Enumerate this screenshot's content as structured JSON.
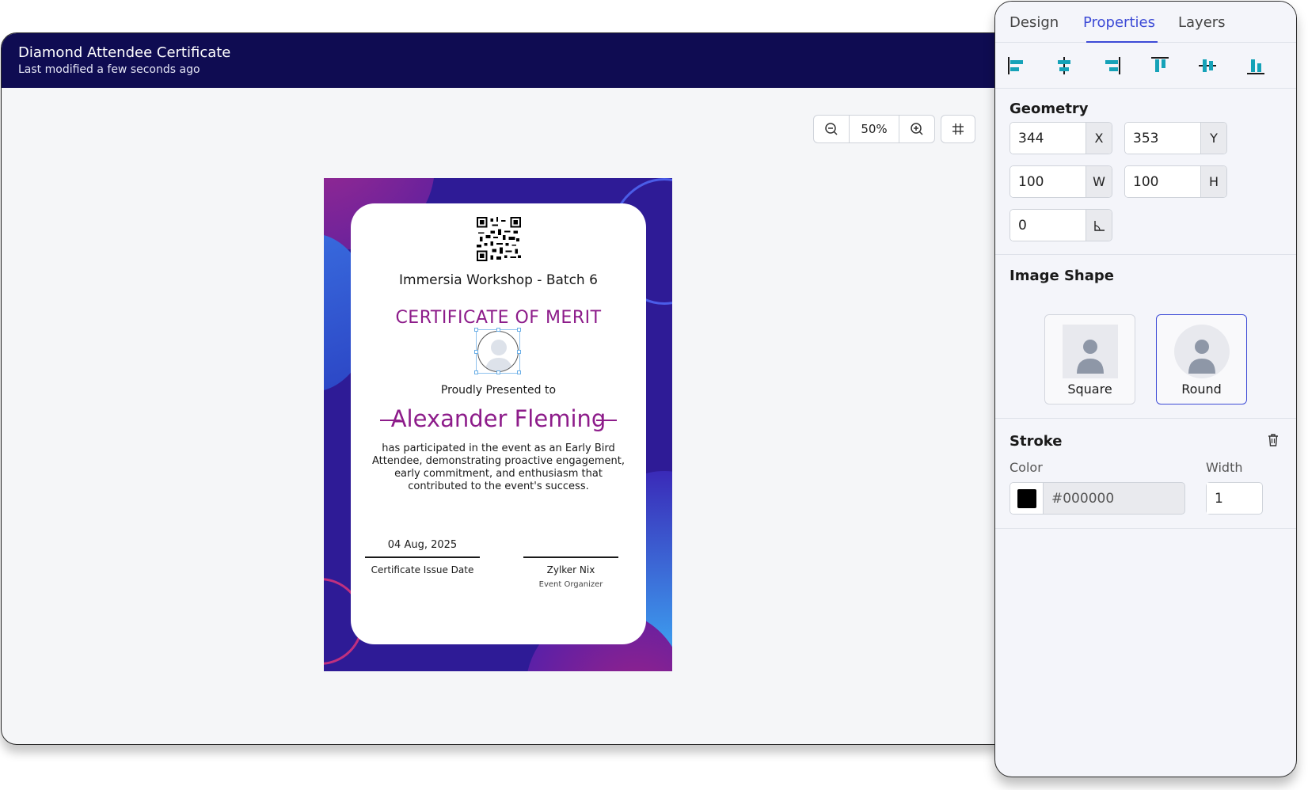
{
  "document": {
    "title": "Diamond Attendee Certificate",
    "last_modified": "Last modified a few seconds ago"
  },
  "zoom": {
    "value": "50%",
    "zoom_out_icon": "zoom-out-icon",
    "zoom_in_icon": "zoom-in-icon",
    "grid_icon": "grid-icon"
  },
  "certificate": {
    "event": "Immersia Workshop - Batch 6",
    "heading": "CERTIFICATE OF MERIT",
    "presented": "Proudly Presented to",
    "recipient": "Alexander Fleming",
    "description": "has participated in the event as an Early Bird Attendee, demonstrating proactive engagement, early commitment, and enthusiasm that contributed to the event's success.",
    "issue_date": "04 Aug, 2025",
    "issue_date_label": "Certificate Issue Date",
    "signer": "Zylker Nix",
    "signer_role": "Event Organizer",
    "colors": {
      "accent": "#8d1c8a",
      "background": "#2e1b96"
    }
  },
  "panel": {
    "tabs": [
      {
        "label": "Design"
      },
      {
        "label": "Properties",
        "active": true
      },
      {
        "label": "Layers"
      }
    ],
    "align_icons": [
      "align-left-icon",
      "align-center-horizontal-icon",
      "align-right-icon",
      "align-top-icon",
      "align-middle-vertical-icon",
      "align-bottom-icon"
    ],
    "geometry": {
      "title": "Geometry",
      "x": "344",
      "x_label": "X",
      "y": "353",
      "y_label": "Y",
      "w": "100",
      "w_label": "W",
      "h": "100",
      "h_label": "H",
      "angle": "0",
      "angle_icon": "angle-icon"
    },
    "image_shape": {
      "title": "Image Shape",
      "options": [
        {
          "label": "Square"
        },
        {
          "label": "Round",
          "selected": true
        }
      ]
    },
    "stroke": {
      "title": "Stroke",
      "color_label": "Color",
      "color": "#000000",
      "width_label": "Width",
      "width": "1",
      "trash_icon": "trash-icon"
    },
    "colors": {
      "accent": "#3d4bd6"
    }
  }
}
